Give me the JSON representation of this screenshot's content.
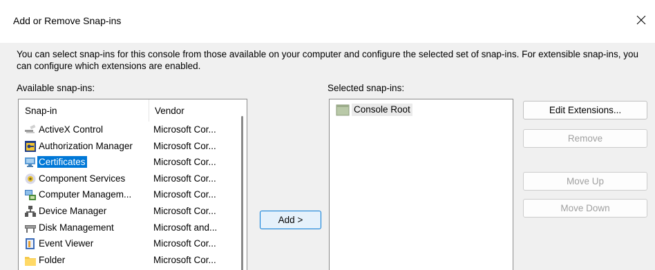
{
  "window": {
    "title": "Add or Remove Snap-ins",
    "close_icon": "close-icon"
  },
  "description": "You can select snap-ins for this console from those available on your computer and configure the selected set of snap-ins. For extensible snap-ins, you can configure which extensions are enabled.",
  "available": {
    "label": "Available snap-ins:",
    "columns": [
      "Snap-in",
      "Vendor"
    ],
    "items": [
      {
        "name": "ActiveX Control",
        "vendor": "Microsoft Cor...",
        "icon": "activex-control-icon"
      },
      {
        "name": "Authorization Manager",
        "vendor": "Microsoft Cor...",
        "icon": "authorization-manager-icon"
      },
      {
        "name": "Certificates",
        "vendor": "Microsoft Cor...",
        "icon": "certificates-icon",
        "selected": true
      },
      {
        "name": "Component Services",
        "vendor": "Microsoft Cor...",
        "icon": "component-services-icon"
      },
      {
        "name": "Computer Managem...",
        "vendor": "Microsoft Cor...",
        "icon": "computer-management-icon"
      },
      {
        "name": "Device Manager",
        "vendor": "Microsoft Cor...",
        "icon": "device-manager-icon"
      },
      {
        "name": "Disk Management",
        "vendor": "Microsoft and...",
        "icon": "disk-management-icon"
      },
      {
        "name": "Event Viewer",
        "vendor": "Microsoft Cor...",
        "icon": "event-viewer-icon"
      },
      {
        "name": "Folder",
        "vendor": "Microsoft Cor...",
        "icon": "folder-icon"
      }
    ]
  },
  "add_button": "Add >",
  "selected": {
    "label": "Selected snap-ins:",
    "items": [
      {
        "name": "Console Root",
        "icon": "console-root-folder-icon"
      }
    ]
  },
  "buttons": {
    "edit_extensions": "Edit Extensions...",
    "remove": "Remove",
    "move_up": "Move Up",
    "move_down": "Move Down"
  },
  "colors": {
    "selection": "#0078d7",
    "disabled_text": "#a0a0a0",
    "window_bg": "#f0f0f0"
  }
}
